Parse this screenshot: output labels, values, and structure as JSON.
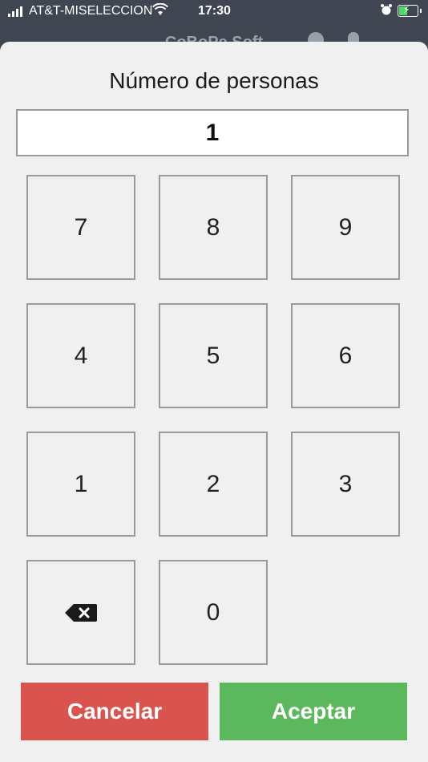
{
  "status_bar": {
    "carrier": "AT&T-MISELECCION",
    "time": "17:30",
    "battery_level_percent": 50
  },
  "background_app": {
    "title": "CoBoPe Soft"
  },
  "dialog": {
    "title": "Número de personas",
    "value": "1",
    "keys": [
      "7",
      "8",
      "9",
      "4",
      "5",
      "6",
      "1",
      "2",
      "3"
    ],
    "zero_key": "0",
    "backspace_icon": "backspace-icon",
    "cancel_label": "Cancelar",
    "accept_label": "Aceptar",
    "colors": {
      "cancel": "#d9534f",
      "accept": "#5cb85c"
    }
  }
}
